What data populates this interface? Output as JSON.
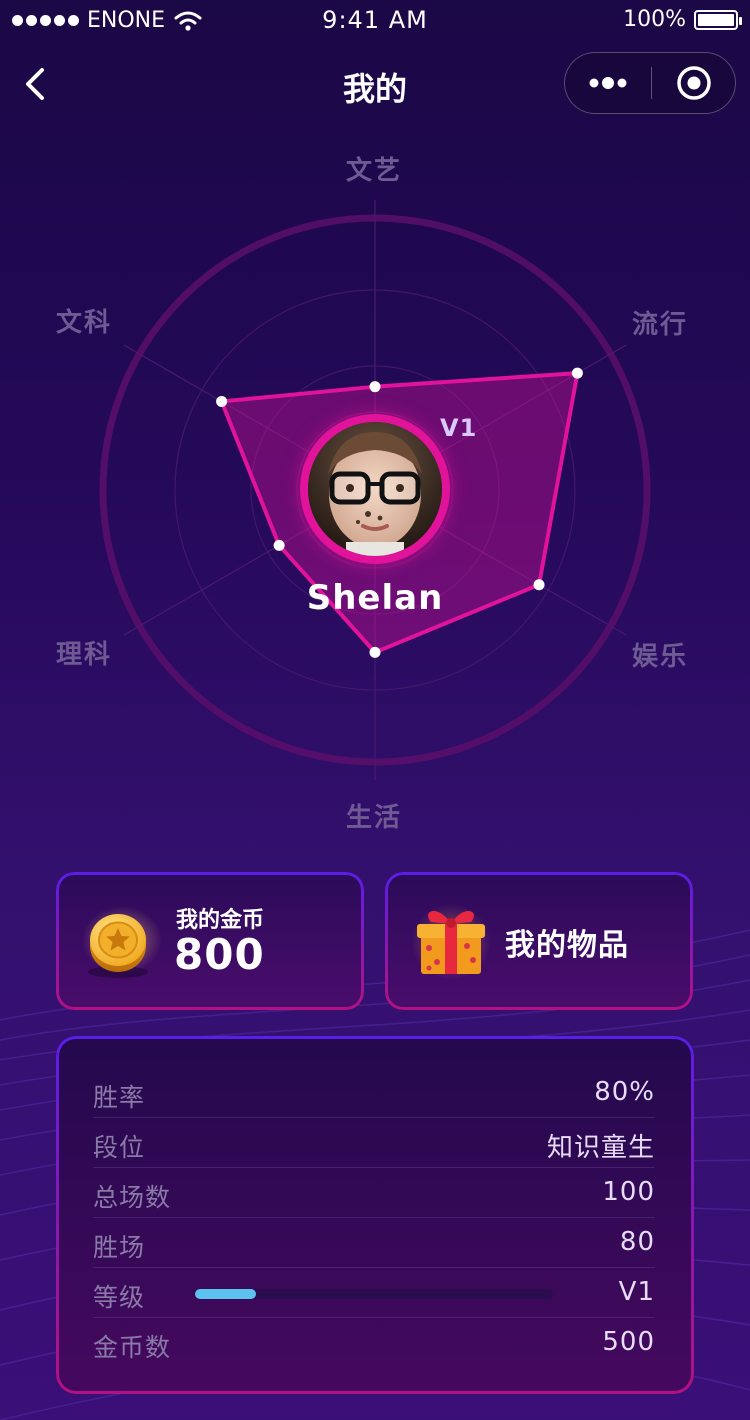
{
  "status_bar": {
    "carrier": "ENONE",
    "time": "9:41 AM",
    "battery": "100%"
  },
  "nav": {
    "title": "我的"
  },
  "radar": {
    "axes": [
      {
        "label": "文艺",
        "value": 0.42
      },
      {
        "label": "流行",
        "value": 0.95
      },
      {
        "label": "娱乐",
        "value": 0.77
      },
      {
        "label": "生活",
        "value": 0.66
      },
      {
        "label": "理科",
        "value": 0.45
      },
      {
        "label": "文科",
        "value": 0.72
      }
    ],
    "colors": {
      "accent": "#e0139a",
      "outer_ring": "#5a0f6b"
    }
  },
  "profile": {
    "name": "Shelan",
    "level": "V1"
  },
  "cards": {
    "coins": {
      "label": "我的金币",
      "value": "800"
    },
    "items": {
      "label": "我的物品"
    }
  },
  "stats": {
    "win_rate": {
      "label": "胜率",
      "value": "80%"
    },
    "rank": {
      "label": "段位",
      "value": "知识童生"
    },
    "total_games": {
      "label": "总场数",
      "value": "100"
    },
    "wins": {
      "label": "胜场",
      "value": "80"
    },
    "level": {
      "label": "等级",
      "value": "V1",
      "progress": 0.17
    },
    "coins": {
      "label": "金币数",
      "value": "500"
    }
  }
}
